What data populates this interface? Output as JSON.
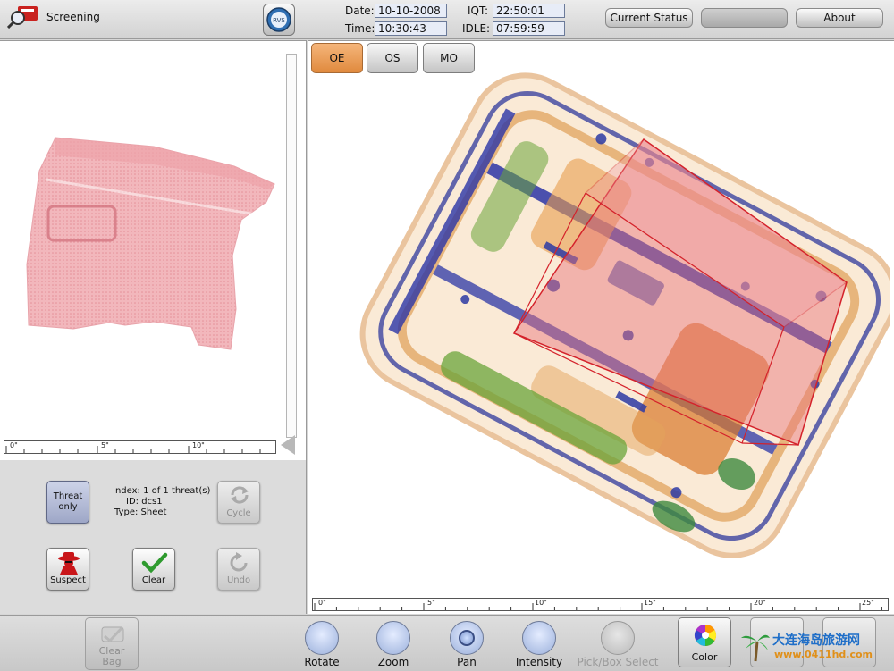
{
  "app": {
    "title": "Screening",
    "logo_text": "RVS"
  },
  "header": {
    "date_label": "Date:",
    "date_value": "10-10-2008",
    "time_label": "Time:",
    "time_value": "10:30:43",
    "iqt_label": "IQT:",
    "iqt_value": "22:50:01",
    "idle_label": "IDLE:",
    "idle_value": "07:59:59",
    "buttons": {
      "current_status": "Current Status",
      "blank": "",
      "about": "About"
    }
  },
  "left_panel": {
    "ruler_ticks": [
      "0\"",
      "5\"",
      "10\""
    ],
    "threat_only_label": "Threat only",
    "threat_info": {
      "index": "Index: 1 of 1 threat(s)",
      "id": "ID: dcs1",
      "type": "Type: Sheet"
    },
    "cycle_label": "Cycle",
    "suspect_label": "Suspect",
    "clear_label": "Clear",
    "undo_label": "Undo"
  },
  "main_view": {
    "tabs": [
      "OE",
      "OS",
      "MO"
    ],
    "active_tab": "OE",
    "ruler_ticks": [
      "0\"",
      "5\"",
      "10\"",
      "15\"",
      "20\"",
      "25\""
    ]
  },
  "toolbar": {
    "clear_bag_label": "Clear Bag",
    "tools": [
      "Rotate",
      "Zoom",
      "Pan",
      "Intensity",
      "Pick/Box Select"
    ],
    "active_tool": "Pan",
    "disabled_tool": "Pick/Box Select",
    "color_label": "Color"
  },
  "watermark": {
    "line1": "大连海岛旅游网",
    "line2": "www.0411hd.com"
  },
  "colors": {
    "accent_tab": "#e08a3e",
    "threat_highlight": "#e8707a",
    "value_box": "#e7ecf7"
  }
}
